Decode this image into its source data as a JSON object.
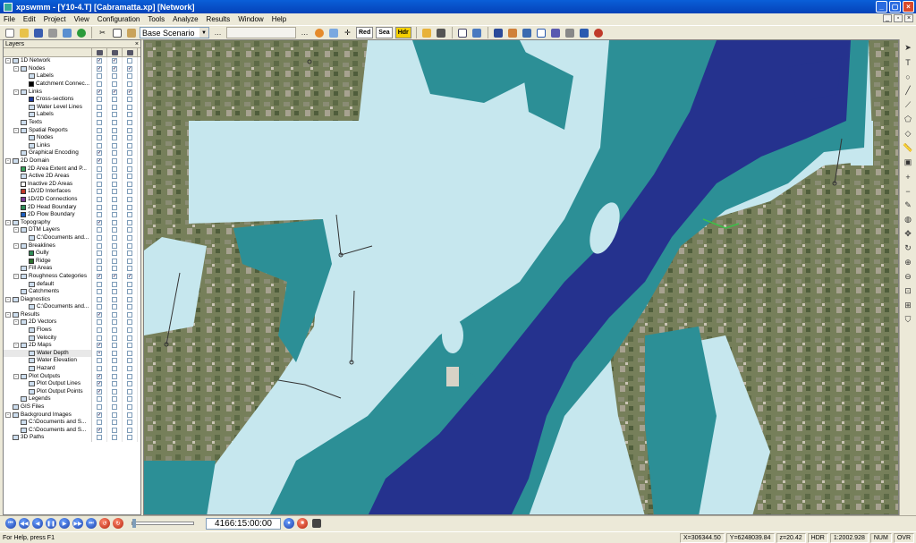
{
  "window": {
    "title": "xpswmm - [Y10-4.T] [Cabramatta.xp] [Network]"
  },
  "menu": [
    "File",
    "Edit",
    "Project",
    "View",
    "Configuration",
    "Tools",
    "Analyze",
    "Results",
    "Window",
    "Help"
  ],
  "toolbar": {
    "scenario": "Base Scenario",
    "btn_red": "Red",
    "btn_sea": "Sea",
    "btn_hdr": "Hdr"
  },
  "layers_panel": {
    "title": "Layers",
    "rows": [
      {
        "label": "1D Network",
        "level": 0,
        "exp": "-",
        "checks": [
          "v",
          "v",
          ""
        ]
      },
      {
        "label": "Nodes",
        "level": 1,
        "exp": "-",
        "checks": [
          "v",
          "v",
          "v"
        ]
      },
      {
        "label": "Labels",
        "level": 2,
        "exp": "",
        "checks": [
          "",
          "",
          ""
        ]
      },
      {
        "label": "Catchment Connec...",
        "level": 2,
        "exp": "",
        "checks": [
          "",
          "",
          ""
        ],
        "swatch": "#000000"
      },
      {
        "label": "Links",
        "level": 1,
        "exp": "-",
        "checks": [
          "v",
          "v",
          "v"
        ]
      },
      {
        "label": "Cross-sections",
        "level": 2,
        "exp": "",
        "checks": [
          "",
          "",
          ""
        ],
        "swatch": "#1f3c9a"
      },
      {
        "label": "Water Level Lines",
        "level": 2,
        "exp": "",
        "checks": [
          "",
          "",
          ""
        ]
      },
      {
        "label": "Labels",
        "level": 2,
        "exp": "",
        "checks": [
          "",
          "",
          ""
        ]
      },
      {
        "label": "Texts",
        "level": 1,
        "exp": "",
        "checks": [
          "",
          "",
          ""
        ]
      },
      {
        "label": "Spatial Reports",
        "level": 1,
        "exp": "-",
        "checks": [
          "",
          "",
          ""
        ]
      },
      {
        "label": "Nodes",
        "level": 2,
        "exp": "",
        "checks": [
          "",
          "",
          ""
        ]
      },
      {
        "label": "Links",
        "level": 2,
        "exp": "",
        "checks": [
          "",
          "",
          ""
        ]
      },
      {
        "label": "Graphical Encoding",
        "level": 1,
        "exp": "",
        "checks": [
          "v",
          "",
          ""
        ]
      },
      {
        "label": "2D Domain",
        "level": 0,
        "exp": "-",
        "checks": [
          "v",
          "",
          ""
        ]
      },
      {
        "label": "2D Area Extent and P...",
        "level": 1,
        "exp": "",
        "checks": [
          "",
          "",
          ""
        ],
        "swatch": "#3aa35b"
      },
      {
        "label": "Active 2D Areas",
        "level": 1,
        "exp": "",
        "checks": [
          "",
          "",
          ""
        ]
      },
      {
        "label": "Inactive 2D Areas",
        "level": 1,
        "exp": "",
        "checks": [
          "",
          "",
          ""
        ],
        "swatch": "#ffffff"
      },
      {
        "label": "1D/2D Interfaces",
        "level": 1,
        "exp": "",
        "checks": [
          "",
          "",
          ""
        ],
        "swatch": "#c0392b"
      },
      {
        "label": "1D/2D Connections",
        "level": 1,
        "exp": "",
        "checks": [
          "",
          "",
          ""
        ],
        "swatch": "#7d3c98"
      },
      {
        "label": "2D Head Boundary",
        "level": 1,
        "exp": "",
        "checks": [
          "",
          "",
          ""
        ],
        "swatch": "#2e8b57"
      },
      {
        "label": "2D Flow Boundary",
        "level": 1,
        "exp": "",
        "checks": [
          "",
          "",
          ""
        ],
        "swatch": "#1f5fbf"
      },
      {
        "label": "Topography",
        "level": 0,
        "exp": "-",
        "checks": [
          "v",
          "",
          ""
        ]
      },
      {
        "label": "DTM Layers",
        "level": 1,
        "exp": "-",
        "checks": [
          "",
          "",
          ""
        ]
      },
      {
        "label": "C:\\Documents and...",
        "level": 2,
        "exp": "",
        "checks": [
          "",
          "",
          ""
        ]
      },
      {
        "label": "Breaklines",
        "level": 1,
        "exp": "-",
        "checks": [
          "",
          "",
          ""
        ]
      },
      {
        "label": "Gully",
        "level": 2,
        "exp": "",
        "checks": [
          "",
          "",
          ""
        ],
        "swatch": "#2e8b57"
      },
      {
        "label": "Ridge",
        "level": 2,
        "exp": "",
        "checks": [
          "",
          "",
          ""
        ],
        "swatch": "#2d6e2d"
      },
      {
        "label": "Fill Areas",
        "level": 1,
        "exp": "",
        "checks": [
          "",
          "",
          ""
        ]
      },
      {
        "label": "Roughness Categories",
        "level": 1,
        "exp": "-",
        "checks": [
          "v",
          "v",
          "v"
        ]
      },
      {
        "label": "default",
        "level": 2,
        "exp": "",
        "checks": [
          "",
          "",
          ""
        ]
      },
      {
        "label": "Catchments",
        "level": 1,
        "exp": "",
        "checks": [
          "",
          "",
          ""
        ]
      },
      {
        "label": "Diagnostics",
        "level": 0,
        "exp": "-",
        "checks": [
          "",
          "",
          ""
        ]
      },
      {
        "label": "C:\\Documents and...",
        "level": 2,
        "exp": "",
        "checks": [
          "",
          "",
          ""
        ]
      },
      {
        "label": "Results",
        "level": 0,
        "exp": "-",
        "checks": [
          "v",
          "",
          ""
        ]
      },
      {
        "label": "2D Vectors",
        "level": 1,
        "exp": "-",
        "checks": [
          "",
          "",
          ""
        ]
      },
      {
        "label": "Flows",
        "level": 2,
        "exp": "",
        "checks": [
          "",
          "",
          ""
        ]
      },
      {
        "label": "Velocity",
        "level": 2,
        "exp": "",
        "checks": [
          "",
          "",
          ""
        ]
      },
      {
        "label": "2D Maps",
        "level": 1,
        "exp": "-",
        "checks": [
          "v",
          "",
          ""
        ]
      },
      {
        "label": "Water Depth",
        "level": 2,
        "exp": "",
        "checks": [
          "•",
          "",
          ""
        ],
        "selected": true
      },
      {
        "label": "Water Elevation",
        "level": 2,
        "exp": "",
        "checks": [
          "",
          "",
          ""
        ]
      },
      {
        "label": "Hazard",
        "level": 2,
        "exp": "",
        "checks": [
          "",
          "",
          ""
        ]
      },
      {
        "label": "Plot Outputs",
        "level": 1,
        "exp": "-",
        "checks": [
          "v",
          "",
          ""
        ]
      },
      {
        "label": "Plot Output Lines",
        "level": 2,
        "exp": "",
        "checks": [
          "v",
          "",
          ""
        ]
      },
      {
        "label": "Plot Output Points",
        "level": 2,
        "exp": "",
        "checks": [
          "v",
          "",
          ""
        ]
      },
      {
        "label": "Legends",
        "level": 1,
        "exp": "",
        "checks": [
          "",
          "",
          ""
        ]
      },
      {
        "label": "GIS Files",
        "level": 0,
        "exp": "",
        "checks": [
          "",
          "",
          ""
        ]
      },
      {
        "label": "Background Images",
        "level": 0,
        "exp": "-",
        "checks": [
          "v",
          "",
          ""
        ]
      },
      {
        "label": "C:\\Documents and S...",
        "level": 1,
        "exp": "",
        "checks": [
          "",
          "",
          ""
        ]
      },
      {
        "label": "C:\\Documents and S...",
        "level": 1,
        "exp": "",
        "checks": [
          "v",
          "",
          ""
        ]
      },
      {
        "label": "3D Paths",
        "level": 0,
        "exp": "",
        "checks": [
          "",
          "",
          ""
        ]
      }
    ]
  },
  "map": {
    "colors": {
      "deep": "#25328e",
      "mid": "#2c8f96",
      "shallow": "#c6e7ee",
      "aerial": "#767f5a",
      "building": "#d7d2c6"
    }
  },
  "playback": {
    "time": "4166:15:00:00"
  },
  "status": {
    "message": "For Help, press F1",
    "x": "X=306344.50",
    "y": "Y=6248039.84",
    "z": "z=20.42",
    "hdr": "HDR",
    "scale": "1:2002.928",
    "num": "NUM",
    "ovr": "OVR"
  }
}
